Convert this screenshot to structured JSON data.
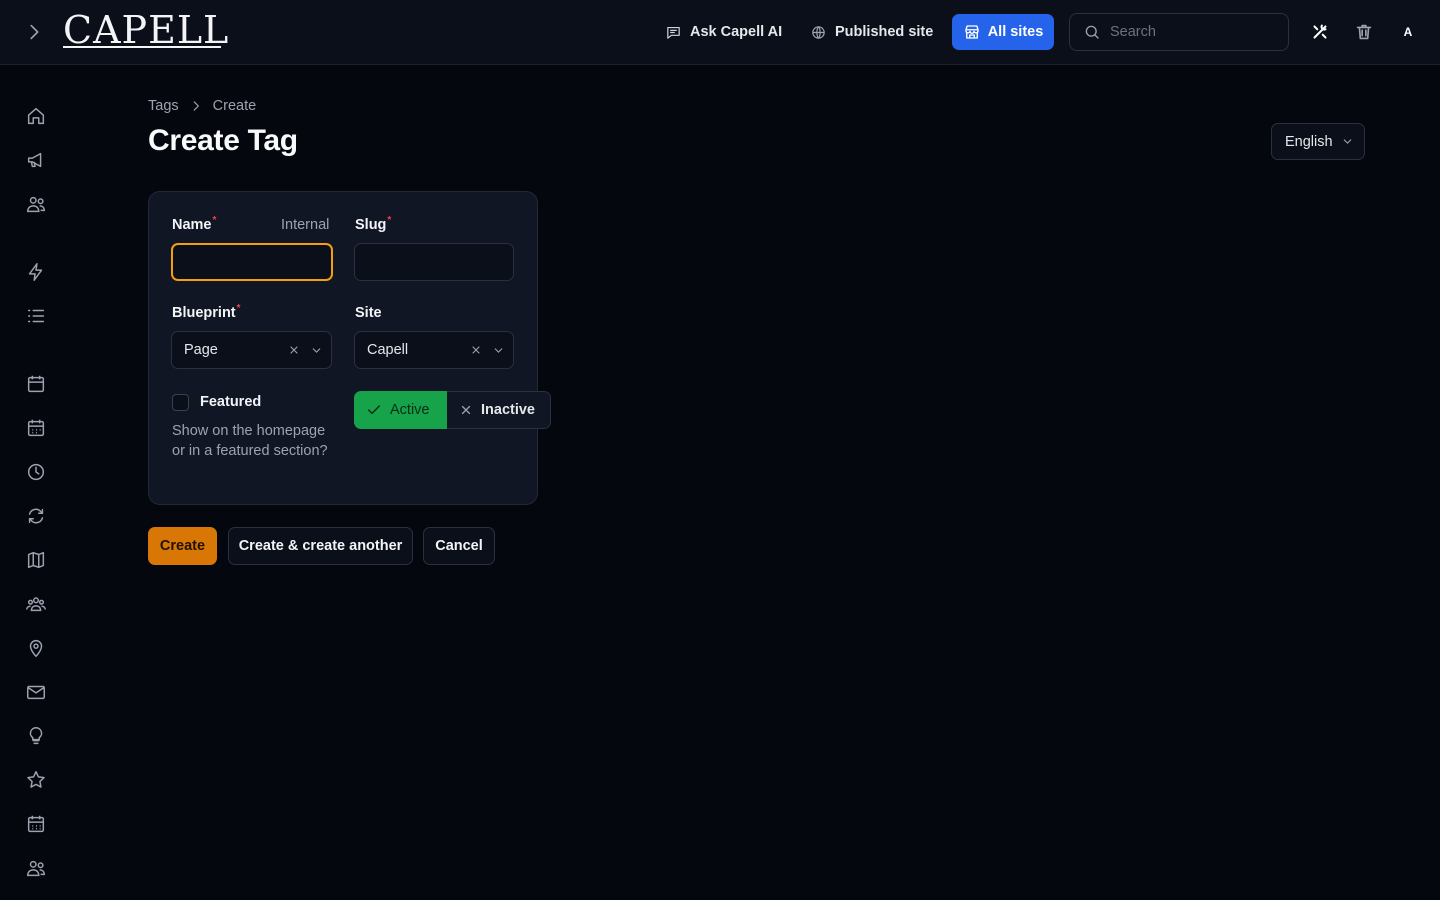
{
  "header": {
    "logo": "CAPELL",
    "ask_ai": "Ask Capell AI",
    "published_site": "Published site",
    "all_sites": "All sites",
    "search_placeholder": "Search",
    "avatar_initial": "A",
    "accent_color": "#2563eb"
  },
  "sidebar": {
    "icons": [
      "home-icon",
      "megaphone-icon",
      "users-icon",
      "bolt-icon",
      "list-icon",
      "calendar-icon",
      "calendar-days-icon",
      "clock-icon",
      "refresh-icon",
      "map-icon",
      "user-group-icon",
      "map-pin-icon",
      "mail-icon",
      "lightbulb-icon",
      "star-icon",
      "calendar-grid-icon",
      "users-icon"
    ]
  },
  "breadcrumb": {
    "parent": "Tags",
    "current": "Create"
  },
  "page_title": "Create Tag",
  "locale": {
    "selected": "English"
  },
  "form": {
    "name": {
      "label": "Name",
      "hint": "Internal",
      "value": ""
    },
    "slug": {
      "label": "Slug",
      "value": ""
    },
    "blueprint": {
      "label": "Blueprint",
      "value": "Page"
    },
    "site": {
      "label": "Site",
      "value": "Capell"
    },
    "featured": {
      "label": "Featured",
      "help": "Show on the homepage or in a featured section?",
      "checked": false
    },
    "status": {
      "active_label": "Active",
      "inactive_label": "Inactive",
      "selected": "Active",
      "active_color": "#16a34a"
    },
    "required_marker": "*"
  },
  "actions": {
    "create": "Create",
    "create_another": "Create & create another",
    "cancel": "Cancel",
    "primary_color": "#d97706"
  }
}
